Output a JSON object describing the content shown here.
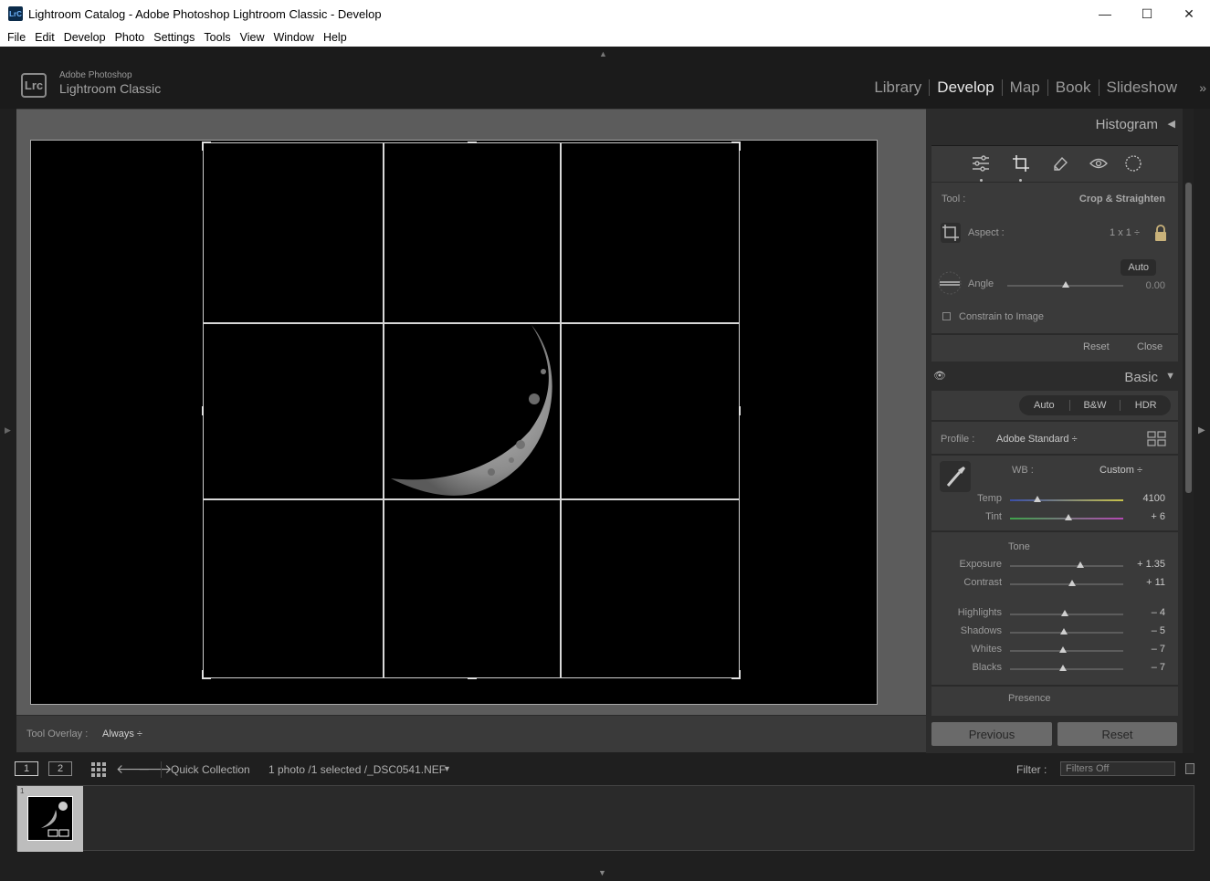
{
  "window": {
    "title": "Lightroom Catalog - Adobe Photoshop Lightroom Classic - Develop",
    "app_icon_text": "LrC",
    "controls": {
      "minimize": "—",
      "maximize": "☐",
      "close": "✕"
    }
  },
  "menu": [
    "File",
    "Edit",
    "Develop",
    "Photo",
    "Settings",
    "Tools",
    "View",
    "Window",
    "Help"
  ],
  "logo": {
    "badge": "Lrc",
    "line1": "Adobe Photoshop",
    "line2": "Lightroom Classic"
  },
  "modules": [
    {
      "label": "Library",
      "active": false
    },
    {
      "label": "Develop",
      "active": true
    },
    {
      "label": "Map",
      "active": false
    },
    {
      "label": "Book",
      "active": false
    },
    {
      "label": "Slideshow",
      "active": false
    }
  ],
  "tool_overlay": {
    "label": "Tool Overlay :",
    "value": "Always ÷"
  },
  "histogram": {
    "title": "Histogram"
  },
  "crop": {
    "tool_label": "Tool :",
    "tool_value": "Crop & Straighten",
    "aspect_label": "Aspect :",
    "aspect_value": "1 x 1 ÷",
    "auto_label": "Auto",
    "angle_label": "Angle",
    "angle_value": "0.00",
    "angle_fraction": 0.5,
    "constrain_label": "Constrain to Image",
    "reset_label": "Reset",
    "close_label": "Close"
  },
  "basic": {
    "title": "Basic",
    "buttons": [
      "Auto",
      "B&W",
      "HDR"
    ],
    "profile_label": "Profile :",
    "profile_value": "Adobe Standard ÷",
    "wb_label": "WB :",
    "wb_value": "Custom ÷",
    "tone_label": "Tone",
    "presence_label": "Presence",
    "sliders": [
      {
        "label": "Temp",
        "value": "4100",
        "fraction": 0.24
      },
      {
        "label": "Tint",
        "value": "+ 6",
        "fraction": 0.52
      },
      {
        "label": "Exposure",
        "value": "+ 1.35",
        "fraction": 0.62
      },
      {
        "label": "Contrast",
        "value": "+ 11",
        "fraction": 0.55
      },
      {
        "label": "Highlights",
        "value": "– 4",
        "fraction": 0.48
      },
      {
        "label": "Shadows",
        "value": "– 5",
        "fraction": 0.475
      },
      {
        "label": "Whites",
        "value": "– 7",
        "fraction": 0.465
      },
      {
        "label": "Blacks",
        "value": "– 7",
        "fraction": 0.465
      }
    ]
  },
  "actions": {
    "previous": "Previous",
    "reset": "Reset"
  },
  "filmstrip": {
    "monitor1": "1",
    "monitor2": "2",
    "source": "Quick Collection",
    "info": "1 photo /1 selected /_DSC0541.NEF",
    "filter_label": "Filter :",
    "filter_value": "Filters Off",
    "thumb_index": "1"
  }
}
